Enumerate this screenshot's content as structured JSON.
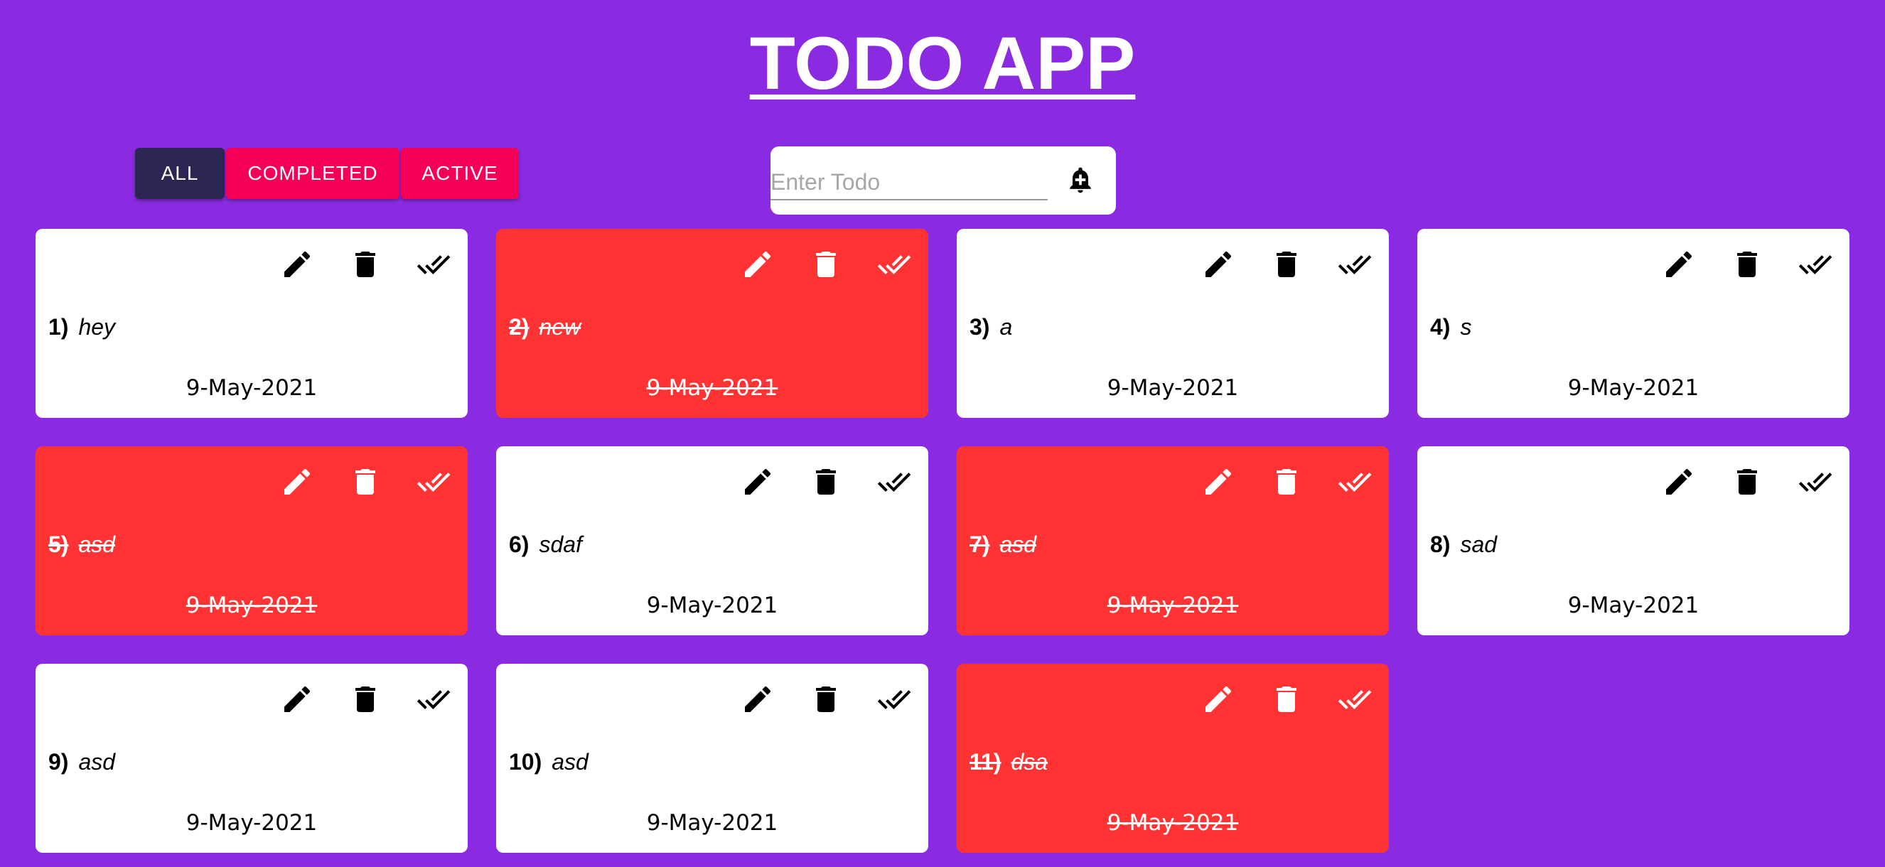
{
  "app": {
    "title": "TODO APP"
  },
  "filters": {
    "all_label": "ALL",
    "completed_label": "COMPLETED",
    "active_label": "ACTIVE"
  },
  "input": {
    "placeholder": "Enter Todo",
    "value": ""
  },
  "icons": {
    "edit": "pencil-icon",
    "delete": "trash-icon",
    "complete": "double-check-icon",
    "add": "bell-plus-icon"
  },
  "colors": {
    "background": "#8a2be2",
    "card_active": "#ffffff",
    "card_completed": "#ff3333",
    "filter_selected": "#2b2652",
    "filter_unselected": "#f50057"
  },
  "todos": [
    {
      "number": "1)",
      "text": "hey",
      "date": "9-May-2021",
      "completed": false
    },
    {
      "number": "2)",
      "text": "new",
      "date": "9-May-2021",
      "completed": true
    },
    {
      "number": "3)",
      "text": "a",
      "date": "9-May-2021",
      "completed": false
    },
    {
      "number": "4)",
      "text": "s",
      "date": "9-May-2021",
      "completed": false
    },
    {
      "number": "5)",
      "text": "asd",
      "date": "9-May-2021",
      "completed": true
    },
    {
      "number": "6)",
      "text": "sdaf",
      "date": "9-May-2021",
      "completed": false
    },
    {
      "number": "7)",
      "text": "asd",
      "date": "9-May-2021",
      "completed": true
    },
    {
      "number": "8)",
      "text": "sad",
      "date": "9-May-2021",
      "completed": false
    },
    {
      "number": "9)",
      "text": "asd",
      "date": "9-May-2021",
      "completed": false
    },
    {
      "number": "10)",
      "text": "asd",
      "date": "9-May-2021",
      "completed": false
    },
    {
      "number": "11)",
      "text": "dsa",
      "date": "9-May-2021",
      "completed": true
    }
  ]
}
